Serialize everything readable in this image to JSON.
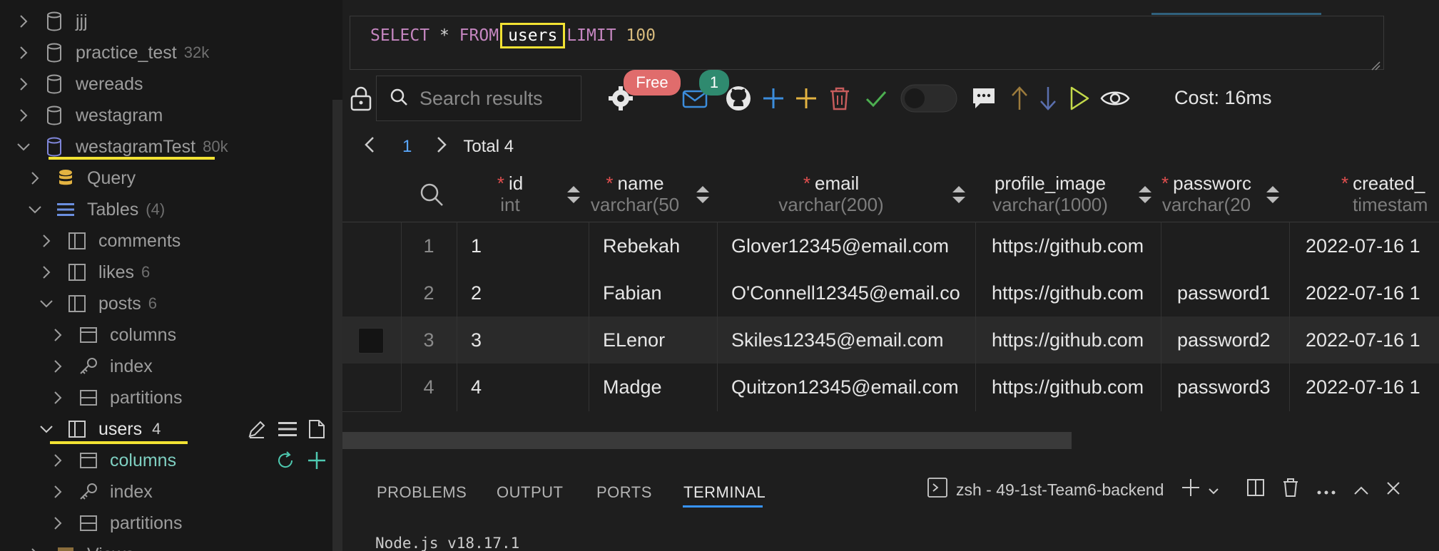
{
  "sidebar": {
    "items": [
      {
        "label": "jjj",
        "meta": ""
      },
      {
        "label": "practice_test",
        "meta": "32k"
      },
      {
        "label": "wereads",
        "meta": ""
      },
      {
        "label": "westagram",
        "meta": ""
      },
      {
        "label": "westagramTest",
        "meta": "80k"
      },
      {
        "label": "Query",
        "meta": ""
      },
      {
        "label": "Tables",
        "meta": "(4)"
      },
      {
        "label": "comments",
        "meta": ""
      },
      {
        "label": "likes",
        "meta": "6"
      },
      {
        "label": "posts",
        "meta": "6"
      },
      {
        "label": "columns",
        "meta": ""
      },
      {
        "label": "index",
        "meta": ""
      },
      {
        "label": "partitions",
        "meta": ""
      },
      {
        "label": "users",
        "meta": "4"
      },
      {
        "label": "columns",
        "meta": ""
      },
      {
        "label": "index",
        "meta": ""
      },
      {
        "label": "partitions",
        "meta": ""
      },
      {
        "label": "Views",
        "meta": ""
      }
    ]
  },
  "editor": {
    "kw_select": "SELECT",
    "star": "*",
    "kw_from": "FROM",
    "table": "users",
    "kw_limit": "LIMIT",
    "limit": "100"
  },
  "toolbar": {
    "search_placeholder": "Search results",
    "free_badge": "Free",
    "mail_count": "1",
    "cost": "Cost: 16ms"
  },
  "pager": {
    "page": "1",
    "total": "Total 4"
  },
  "grid": {
    "columns": [
      {
        "name": "id",
        "type": "int",
        "required": true
      },
      {
        "name": "name",
        "type": "varchar(50",
        "required": true
      },
      {
        "name": "email",
        "type": "varchar(200)",
        "required": true
      },
      {
        "name": "profile_image",
        "type": "varchar(1000)",
        "required": false
      },
      {
        "name": "passworc",
        "type": "varchar(20",
        "required": true
      },
      {
        "name": "created_",
        "type": "timestam",
        "required": true
      }
    ],
    "rows": [
      {
        "rn": "1",
        "id": "1",
        "name": "Rebekah",
        "email": "Glover12345@email.com",
        "profile_image": "https://github.com",
        "password": "",
        "created": "2022-07-16 1"
      },
      {
        "rn": "2",
        "id": "2",
        "name": "Fabian",
        "email": "O'Connell12345@email.co",
        "profile_image": "https://github.com",
        "password": "password1",
        "created": "2022-07-16 1"
      },
      {
        "rn": "3",
        "id": "3",
        "name": "ELenor",
        "email": "Skiles12345@email.com",
        "profile_image": "https://github.com",
        "password": "password2",
        "created": "2022-07-16 1"
      },
      {
        "rn": "4",
        "id": "4",
        "name": "Madge",
        "email": "Quitzon12345@email.com",
        "profile_image": "https://github.com",
        "password": "password3",
        "created": "2022-07-16 1"
      }
    ]
  },
  "panel": {
    "tabs": [
      "PROBLEMS",
      "OUTPUT",
      "PORTS",
      "TERMINAL"
    ],
    "terminal_name": "zsh - 49-1st-Team6-backend",
    "terminal_output": "Node.js v18.17.1"
  }
}
